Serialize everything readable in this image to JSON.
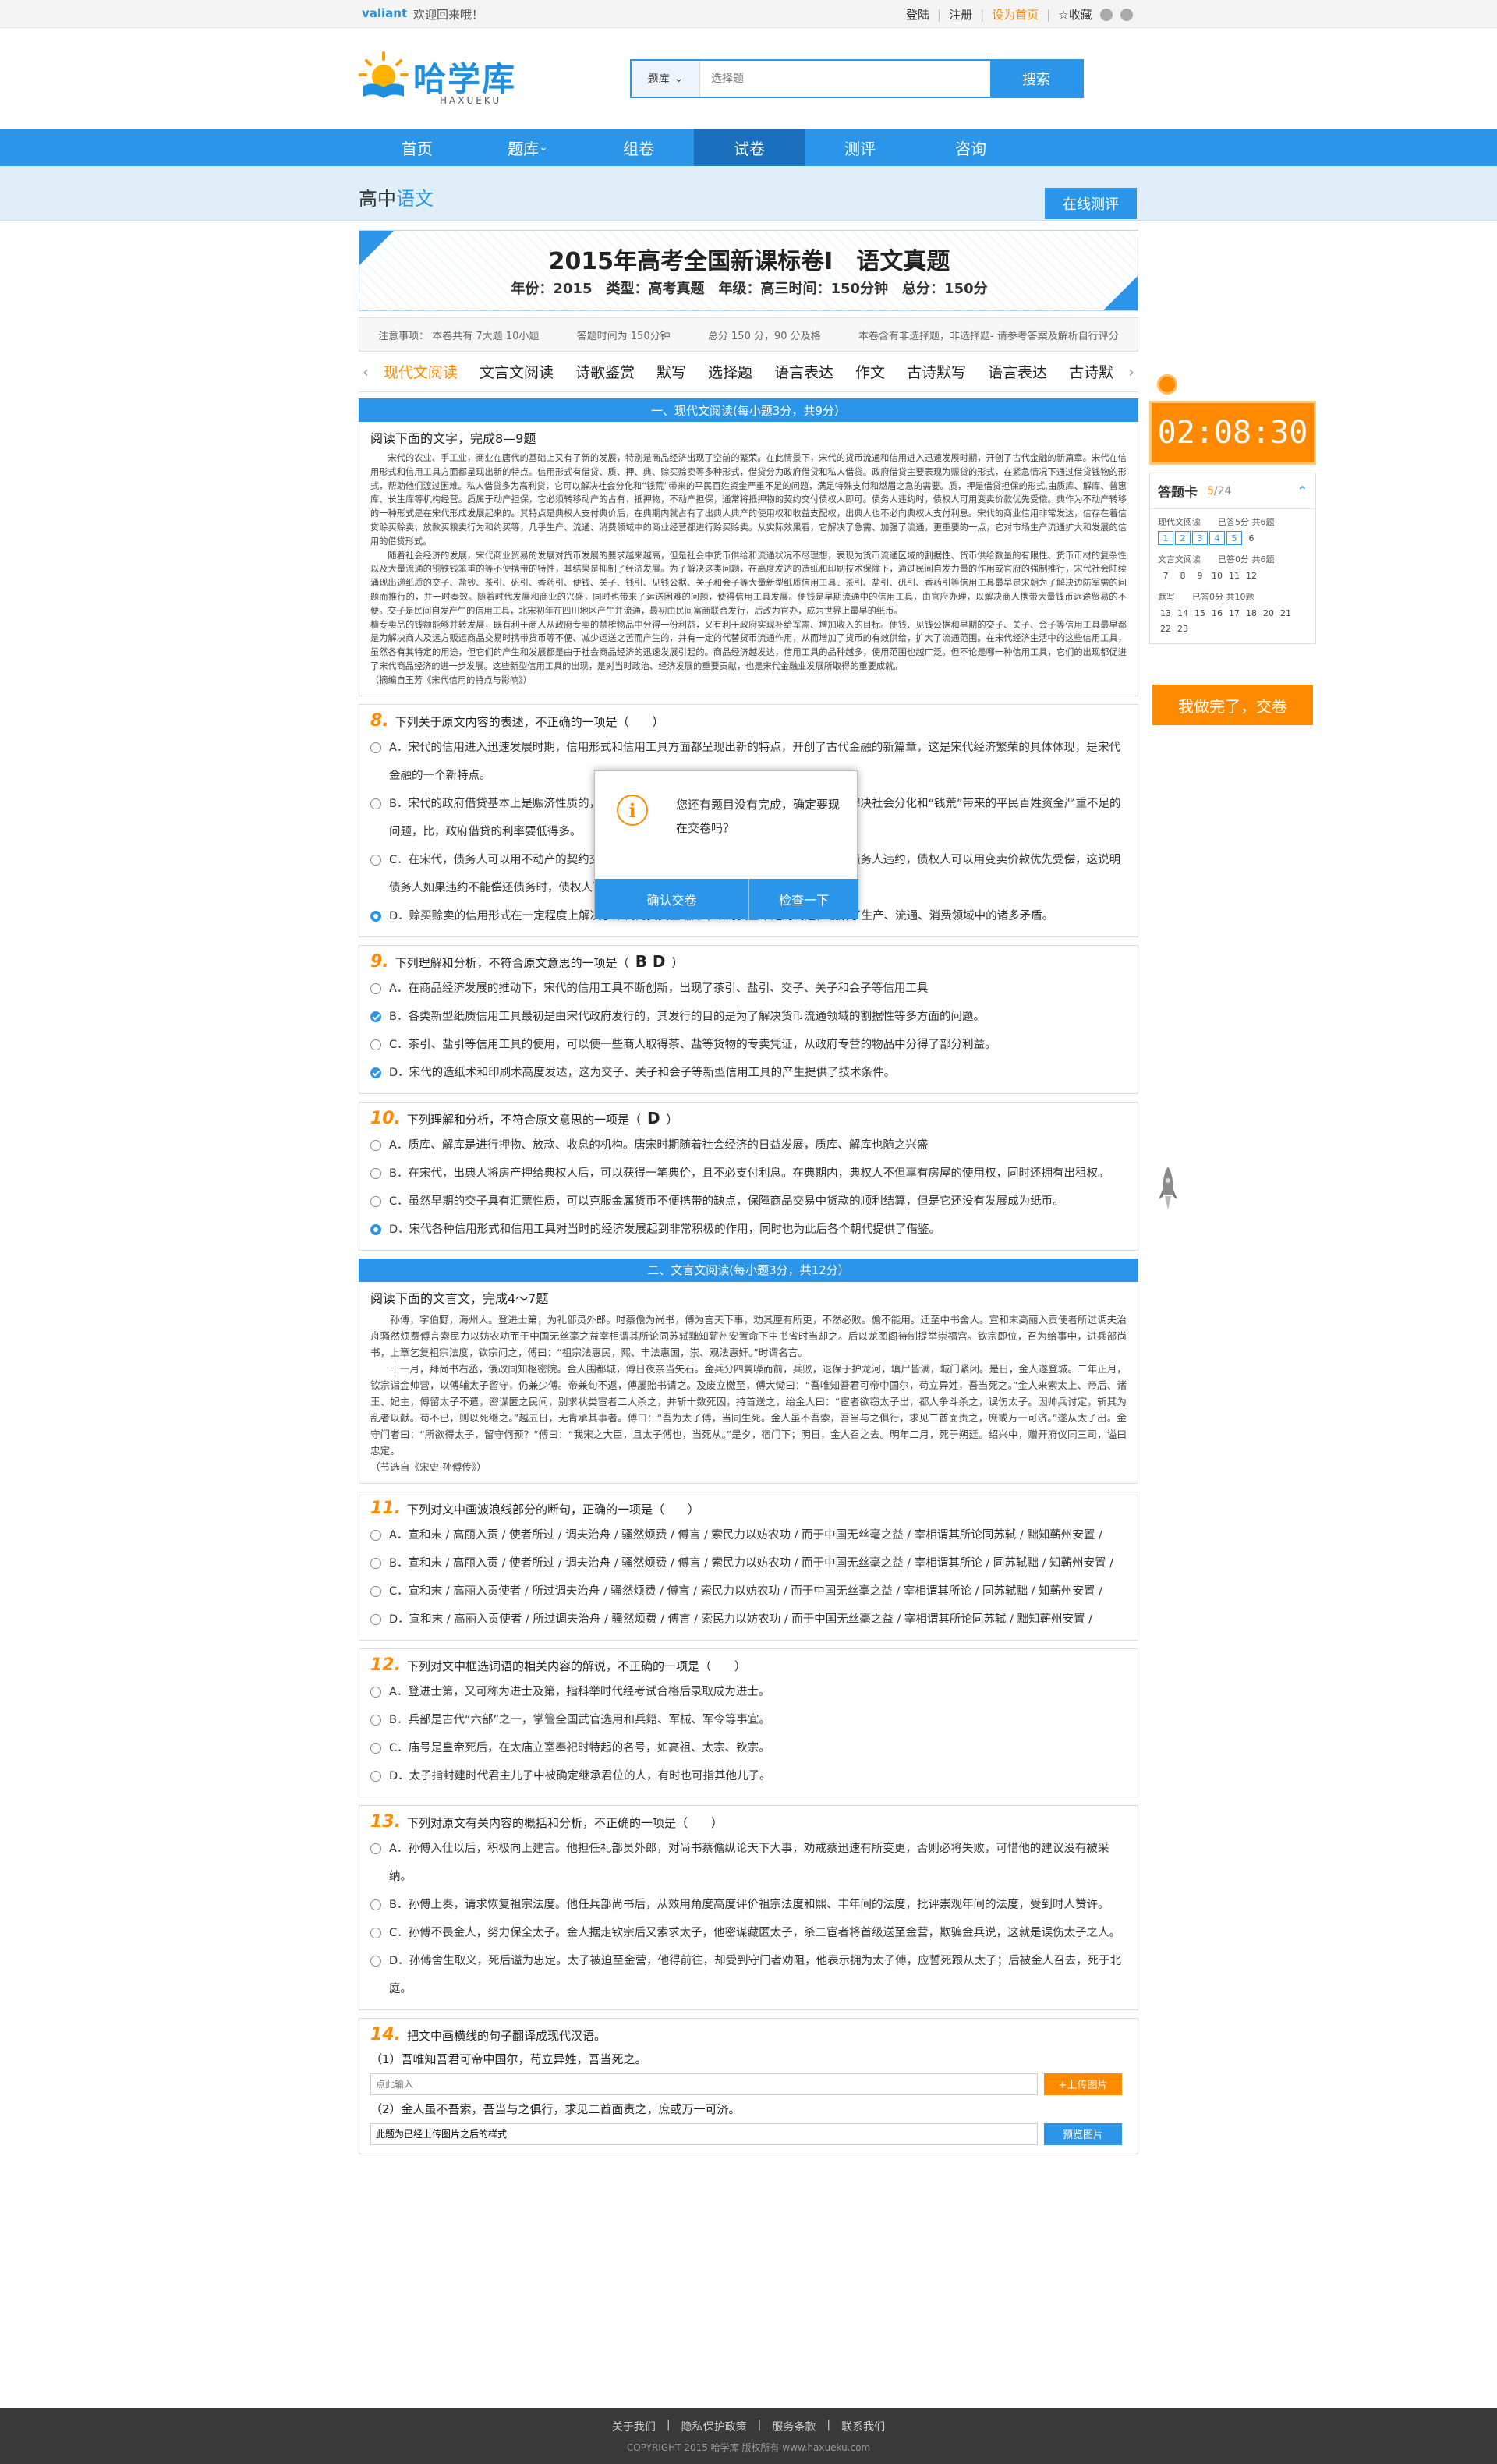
{
  "topbar": {
    "brand": "valiant",
    "welcome": "欢迎回来哦！",
    "login": "登陆",
    "register": "注册",
    "homepage": "设为首页",
    "favorite": "收藏"
  },
  "logo": {
    "cn": "哈学库",
    "en": "HAXUEKU"
  },
  "search": {
    "category": "题库",
    "placeholder": "选择题",
    "button": "搜索"
  },
  "nav": {
    "items": [
      "首页",
      "题库",
      "组卷",
      "试卷",
      "测评",
      "咨询"
    ],
    "active": "试卷"
  },
  "subhead": {
    "prefix": "高中",
    "subject": "语文",
    "online_test": "在线测评"
  },
  "paper": {
    "title": "2015年高考全国新课标卷Ⅰ　语文真题",
    "meta": "年份：2015　类型：高考真题　年级：高三时间：150分钟　总分：150分",
    "notice": [
      "注意事项：  本卷共有 7大题 10小题",
      "答题时间为 150分钟",
      "总分 150 分，90 分及格",
      "本卷含有非选择题，非选择题- 请参考答案及解析自行评分"
    ],
    "tabs": [
      "现代文阅读",
      "文言文阅读",
      "诗歌鉴赏",
      "默写",
      "选择题",
      "语言表达",
      "作文",
      "古诗默写",
      "语言表达",
      "古诗默"
    ],
    "active_tab": "现代文阅读"
  },
  "section1": {
    "bar": "一、现代文阅读(每小题3分，共9分）",
    "head": "阅读下面的文字，完成8—9题",
    "paras": [
      "宋代的农业、手工业，商业在唐代的基础上又有了新的发展，特别是商品经济出现了空前的繁荣。在此情景下，宋代的货币流通和信用进入迅速发展时期，开创了古代金融的新篇章。宋代在信用形式和信用工具方面都呈现出新的特点。信用形式有借贷、质、押、典、赊买赊卖等多种形式，借贷分为政府借贷和私人借贷。政府借贷主要表现为赈贷的形式，在紧急情况下通过借贷钱物的形式，帮助他们渡过困难。私人借贷多为高利贷，它可以解决社会分化和“钱荒”带来的平民百姓资金严重不足的问题，满足特殊支付和燃眉之急的需要。质，押是借贷担保的形式,由质库、解库、普惠库、长生库等机构经营。质属于动产担保，它必须转移动产的占有，抵押物，不动产担保，通常将抵押物的契约交付债权人即可。债务人违约时，债权人可用变卖价款优先受偿。典作为不动产转移的一种形式是在宋代形成发展起来的。其特点是典权人支付典价后，在典期内就占有了出典人典产的使用权和收益支配权，出典人也不必向典权人支付利息。宋代的商业信用非常发达，信存在着信贷赊买赊卖，放款买粮卖行为和约买等，几乎生产、流通、消费领域中的商业经营都进行赊买赊卖。从实际效果看，它解决了急需、加强了流通，更重要的一点，它对市场生产流通扩大和发展的信用的借贷形式。",
      "随着社会经济的发展，宋代商业贸易的发展对货币发展的要求越来越高，但是社会中货币供给和流通状况不尽理想，表现为货币流通区域的割据性、货币供给数量的有限性、货币币材的复杂性以及大量流通的铜铁钱笨重的等不便携带的特性，其结果是抑制了经济发展。为了解决这类问题，在高度发达的造纸和印刷技术保障下，通过民间自发力量的作用或官府的强制推行，宋代社会陆续涌现出递纸质的交子、盐钞、茶引、矾引、香药引、便钱、关子、钱引、见钱公据、关子和会子等大量新型纸质信用工具．茶引、盐引、矾引、香药引等信用工具最早是宋朝为了解决边防军需的问题而推行的，并一时奏效。随着时代发展和商业的兴盛，同时也带来了运送困难的问题，使得信用工具发展。便钱是早期流通中的信用工具，由官府办理，以解决商人携带大量钱币远途贸易的不便。交子是民间自发产生的信用工具，北宋初年在四川地区产生并流通，最初由民间富商联合发行，后改为官办，成为世界上最早的纸币。",
      "檀专卖品的钱额能够并转发展，既有利于商人从政府专卖的禁榷物品中分得一份利益，又有利于政府实现补给军需、增加收入的目标。便钱、见钱公据和早期的交子、关子、会子等信用工具最早都是为解决商人及远方贩运商品交易时携带货币等不便、减少运送之苦而产生的，并有一定的代替货币流通作用，从而增加了货币的有效供给，扩大了流通范围。在宋代经济生活中的这些信用工具，虽然各有其特定的用途，但它们的产生和发展都是由于社会商品经济的迅速发展引起的。商品经济越发达，信用工具的品种越多，使用范围也越广泛。但不论是哪一种信用工具，它们的出现都促进了宋代商品经济的进一步发展。这些新型信用工具的出现，是对当时政治、经济发展的重要贡献，也是宋代金融业发展所取得的重要成就。",
      "（摘编自王芳《宋代信用的特点与影响》）"
    ]
  },
  "q8": {
    "num": "8.",
    "stem": "下列关于原文内容的表述，不正确的一项是（　　）",
    "options": [
      "A．宋代的信用进入迅速发展时期，信用形式和信用工具方面都呈现出新的特点，开创了古代金融的新篇章，这是宋代经济繁荣的具体体现，是宋代金融的一个新特点。",
      "B．宋代的政府借贷基本上是赈济性质的，帮助人们渡过困难，而私人借贷多为高利贷，可以解决社会分化和“钱荒”带来的平民百姓资金严重不足的问题，比，政府借贷的利率要低得多。",
      "C．在宋代，债务人可以用不动产的契约交付债权人作为抵押，不必转移不动产的占有，如果债务人违约，债权人可以用变卖价款优先受偿，这说明债务人如果违约不能偿还债务时，债权人可用变卖价款优先受偿。",
      "D．赊买赊卖的信用形式在一定程度上解决了宋代商贸资金缩滞带来的资金不足的问题，缓解了生产、流通、消费领域中的诸多矛盾。"
    ],
    "selected": 3
  },
  "q9": {
    "num": "9.",
    "stem": "下列理解和分析，不符合原文意思的一项是（",
    "answer": "B D",
    "stem_end": "）",
    "options": [
      "A．在商品经济发展的推动下，宋代的信用工具不断创新，出现了茶引、盐引、交子、关子和会子等信用工具",
      "B．各类新型纸质信用工具最初是由宋代政府发行的，其发行的目的是为了解决货币流通领域的割据性等多方面的问题。",
      "C．茶引、盐引等信用工具的使用，可以使一些商人取得茶、盐等货物的专卖凭证，从政府专营的物品中分得了部分利益。",
      "D．宋代的造纸术和印刷术高度发达，这为交子、关子和会子等新型信用工具的产生提供了技术条件。"
    ],
    "checked": [
      1,
      3
    ]
  },
  "q10": {
    "num": "10.",
    "stem": "下列理解和分析，不符合原文意思的一项是（",
    "answer": "D",
    "stem_end": "）",
    "options": [
      "A．质库、解库是进行押物、放款、收息的机构。唐宋时期随着社会经济的日益发展，质库、解库也随之兴盛",
      "B．在宋代，出典人将房产押给典权人后，可以获得一笔典价，且不必支付利息。在典期内，典权人不但享有房屋的使用权，同时还拥有出租权。",
      "C．虽然早期的交子具有汇票性质，可以克服金属货币不便携带的缺点，保障商品交易中货款的顺利结算，但是它还没有发展成为纸币。",
      "D．宋代各种信用形式和信用工具对当时的经济发展起到非常积极的作用，同时也为此后各个朝代提供了借鉴。"
    ],
    "selected": 3
  },
  "section2": {
    "bar": "二、文言文阅读(每小题3分，共12分）",
    "head": "阅读下面的文言文，完成4～7题",
    "paras": [
      "孙傅，字伯野，海州人。登进士第，为礼部员外郎。时蔡儋为尚书，傅为言天下事，劝其厘有所更，不然必败。儋不能用。迁至中书舍人。宣和末高丽入贡使者所过调夫治舟骚然烦费傅言索民力以妨农功而于中国无丝毫之益宰相谓其所论同苏轼黜知蕲州安置命下中书省时当却之。后以龙图阁待制提举崇福宫。钦宗即位，召为给事中，进兵部尚书，上章乞复祖宗法度，钦宗问之，傅曰：“祖宗法惠民，熙、丰法惠国，崇、观法惠奸。”时谓名言。",
      "十一月，拜尚书右丞，俄改同知枢密院。金人围都城，傅日夜亲当矢石。金兵分四翼噪而前，兵败，退保于护龙河，填尸皆满，城门紧闭。是日，金人遂登城。二年正月，钦宗诣金帅营，以傅辅太子留守，仍兼少傅。帝兼旬不返，傅屡贻书请之。及废立檄至，傅大恸曰：“吾唯知吾君可帝中国尔，苟立异姓，吾当死之。”金人来索太上、帝后、诸王、妃主，傅留太子不遣，密谋匿之民间，别求状类宦者二人杀之，并斩十数死囚，持首送之，绐金人曰：“宦者欲窃太子出，都人争斗杀之，误伤太子。因帅兵讨定，斩其为乱者以献。苟不已，则以死继之。”越五日，无肯承其事者。傅曰：“吾为太子傅，当同生死。金人虽不吾索，吾当与之俱行，求见二酋面责之，庶或万一可济。”遂从太子出。金守门者曰：“所欲得太子，留守何预？”傅曰：“我宋之大臣，且太子傅也，当死从。”是夕，宿门下；明日，金人召之去。明年二月，死于朔廷。绍兴中，赠开府仪同三司，谥曰忠定。",
      "（节选自《宋史·孙傅传》）"
    ]
  },
  "q11": {
    "num": "11.",
    "stem": "下列对文中画波浪线部分的断句，正确的一项是（　　）",
    "options": [
      "A．宣和末 / 高丽入贡 / 使者所过 / 调夫治舟 / 骚然烦费 / 傅言 / 索民力以妨农功 / 而于中国无丝毫之益 / 宰相谓其所论同苏轼 / 黜知蕲州安置 /",
      "B．宣和末 / 高丽入贡 / 使者所过 / 调夫治舟 / 骚然烦费 / 傅言 / 索民力以妨农功 / 而于中国无丝毫之益 / 宰相谓其所论 / 同苏轼黜 / 知蕲州安置 /",
      "C．宣和末 / 高丽入贡使者 / 所过调夫治舟 / 骚然烦费 / 傅言 / 索民力以妨农功 / 而于中国无丝毫之益 / 宰相谓其所论 / 同苏轼黜 / 知蕲州安置 /",
      "D．宣和末 / 高丽入贡使者 / 所过调夫治舟 / 骚然烦费 / 傅言 / 索民力以妨农功 / 而于中国无丝毫之益 / 宰相谓其所论同苏轼 / 黜知蕲州安置 /"
    ]
  },
  "q12": {
    "num": "12.",
    "stem": "下列对文中框选词语的相关内容的解说，不正确的一项是（　　）",
    "options": [
      "A．登进士第，又可称为进士及第，指科举时代经考试合格后录取成为进士。",
      "B．兵部是古代“六部”之一，掌管全国武官选用和兵籍、军械、军令等事宜。",
      "C．庙号是皇帝死后，在太庙立室奉祀时特起的名号，如高祖、太宗、钦宗。",
      "D．太子指封建时代君主儿子中被确定继承君位的人，有时也可指其他儿子。"
    ]
  },
  "q13": {
    "num": "13.",
    "stem": "下列对原文有关内容的概括和分析，不正确的一项是（　　）",
    "options": [
      "A．孙傅入仕以后，积极向上建言。他担任礼部员外郎，对尚书蔡儋纵论天下大事，劝戒蔡迅速有所变更，否则必将失败，可惜他的建议没有被采纳。",
      "B．孙傅上奏，请求恢复祖宗法度。他任兵部尚书后，从效用角度高度评价祖宗法度和熙、丰年间的法度，批评崇观年间的法度，受到时人赞许。",
      "C．孙傅不畏金人，努力保全太子。金人据走钦宗后又索求太子，他密谋藏匿太子，杀二宦者将首级送至金营，欺骗金兵说，这就是误伤太子之人。",
      "D．孙傅舍生取义，死后谥为忠定。太子被迫至金营，他得前往，却受到守门者劝阻，他表示拥为太子傅，应誓死跟从太子；后被金人召去，死于北庭。"
    ]
  },
  "q14": {
    "num": "14.",
    "stem": "把文中画横线的句子翻译成现代汉语。",
    "s1": "（1）吾唯知吾君可帝中国尔，苟立异姓，吾当死之。",
    "s1_placeholder": "点此输入",
    "upload": "+上传图片",
    "s2": "（2）金人虽不吾索，吾当与之俱行，求见二酋面责之，庶或万一可济。",
    "s2_value": "此题为已经上传图片之后的样式",
    "preview": "预览图片"
  },
  "timer": {
    "value": "02:08:30"
  },
  "answer_card": {
    "title": "答题卡",
    "done": "5",
    "total": "/24",
    "groups": [
      {
        "label": "现代文阅读　　已答5分 共6题",
        "nums": [
          "1",
          "2",
          "3",
          "4",
          "5",
          "6"
        ],
        "done": [
          "1",
          "2",
          "3",
          "4",
          "5"
        ]
      },
      {
        "label": "文言文阅读　　已答0分 共6题",
        "nums": [
          "7",
          "8",
          "9",
          "10",
          "11",
          "12"
        ],
        "done": []
      },
      {
        "label": "默写　　已答0分 共10题",
        "nums": [
          "13",
          "14",
          "15",
          "16",
          "17",
          "18",
          "20",
          "21",
          "22",
          "23"
        ],
        "done": []
      }
    ],
    "submit": "我做完了，交卷"
  },
  "modal": {
    "icon": "i",
    "message": "您还有题目没有完成，确定要现在交卷吗？",
    "confirm": "确认交卷",
    "check": "检查一下"
  },
  "footer": {
    "links": [
      "关于我们",
      "隐私保护政策",
      "服务条款",
      "联系我们"
    ],
    "copyright": "COPYRIGHT 2015  哈学库  版权所有  www.haxueku.com"
  }
}
